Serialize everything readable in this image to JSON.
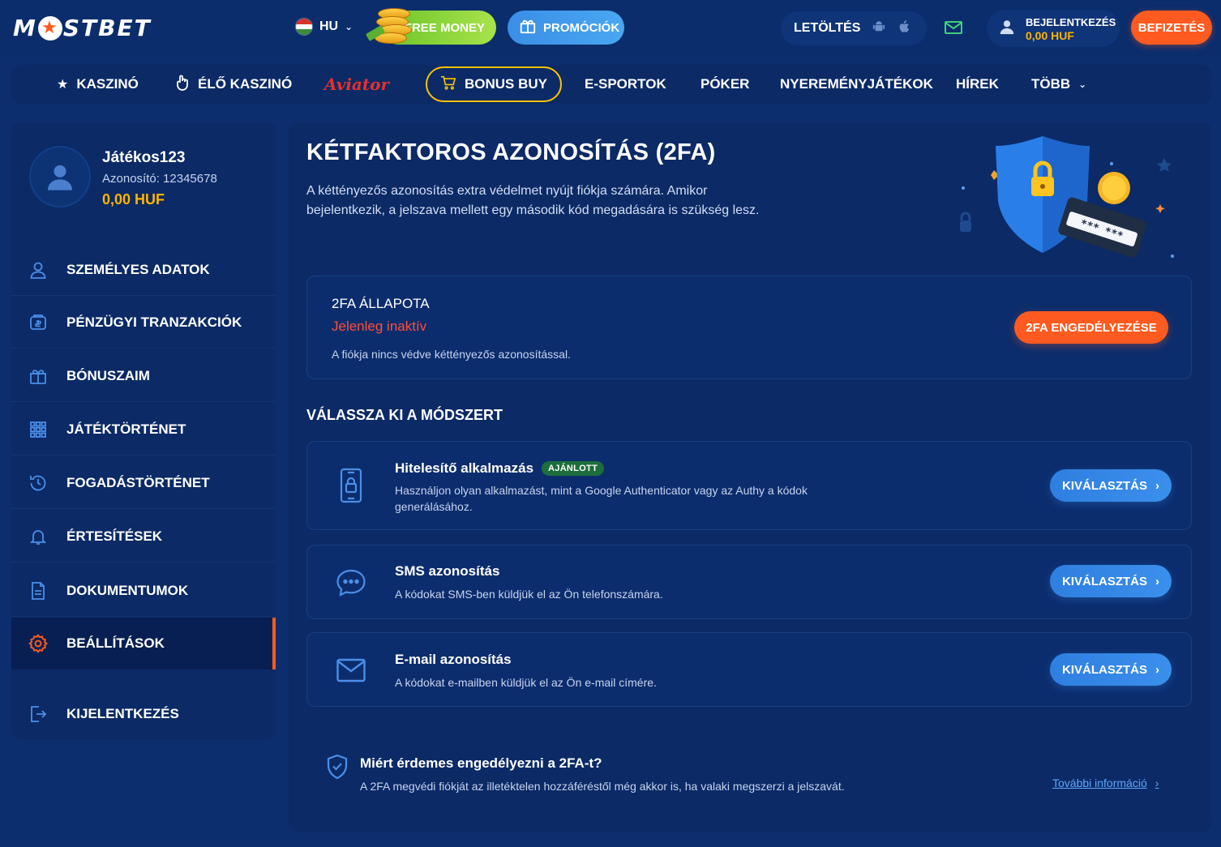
{
  "header": {
    "logo_text_left": "M",
    "logo_text_right": "STBET",
    "language": "HU",
    "free_money": "FREE MONEY",
    "promotions": "PROMÓCIÓK",
    "download": "LETÖLTÉS",
    "login_label": "BEJELENTKEZÉS",
    "login_balance": "0,00 HUF",
    "pay": "BEFIZETÉS"
  },
  "nav": {
    "casino": "KASZINÓ",
    "live_casino": "ÉLŐ KASZINÓ",
    "aviator": "Aviator",
    "bonus_buy": "BONUS BUY",
    "esports": "E-SPORTOK",
    "poker": "PÓKER",
    "lotteries": "NYEREMÉNYJÁTÉKOK",
    "news": "HÍREK",
    "more": "TÖBB"
  },
  "profile": {
    "username": "Játékos123",
    "id_label": "Azonosító: 12345678",
    "balance": "0,00 HUF"
  },
  "sidebar": {
    "items": [
      {
        "label": "SZEMÉLYES ADATOK"
      },
      {
        "label": "PÉNZÜGYI TRANZAKCIÓK"
      },
      {
        "label": "BÓNUSZAIM"
      },
      {
        "label": "JÁTÉKTÖRTÉNET"
      },
      {
        "label": "FOGADÁSTÖRTÉNET"
      },
      {
        "label": "ÉRTESÍTÉSEK"
      },
      {
        "label": "DOKUMENTUMOK"
      },
      {
        "label": "BEÁLLÍTÁSOK"
      },
      {
        "label": "KIJELENTKEZÉS"
      }
    ]
  },
  "main": {
    "title": "KÉTFAKTOROS AZONOSÍTÁS (2FA)",
    "intro": "A kéttényezős azonosítás extra védelmet nyújt fiókja számára. Amikor bejelentkezik, a jelszava mellett egy második kód megadására is szükség lesz.",
    "hero_card_text": "*** ***",
    "status": {
      "title": "2FA ÁLLAPOTA",
      "value": "Jelenleg inaktív",
      "description": "A fiókja nincs védve kéttényezős azonosítással.",
      "enable_button": "2FA ENGEDÉLYEZÉSE"
    },
    "methods_title": "VÁLASSZA KI A MÓDSZERT",
    "methods": [
      {
        "title": "Hitelesítő alkalmazás",
        "badge": "AJÁNLOTT",
        "description": "Használjon olyan alkalmazást, mint a Google Authenticator vagy az Authy a kódok generálásához.",
        "button": "KIVÁLASZTÁS"
      },
      {
        "title": "SMS azonosítás",
        "description": "A kódokat SMS-ben küldjük el az Ön telefonszámára.",
        "button": "KIVÁLASZTÁS"
      },
      {
        "title": "E-mail azonosítás",
        "description": "A kódokat e-mailben küldjük el az Ön e-mail címére.",
        "button": "KIVÁLASZTÁS"
      }
    ],
    "why": {
      "title": "Miért érdemes engedélyezni a 2FA-t?",
      "description": "A 2FA megvédi fiókját az illetéktelen hozzáféréstől még akkor is, ha valaki megszerzi a jelszavát.",
      "link": "További információ"
    }
  },
  "colors": {
    "accent_orange": "#ff5a1f",
    "accent_blue": "#2f7fe0",
    "gold": "#ffb400",
    "error_red": "#ff4d3a",
    "bg_dark": "#0b2a66"
  }
}
